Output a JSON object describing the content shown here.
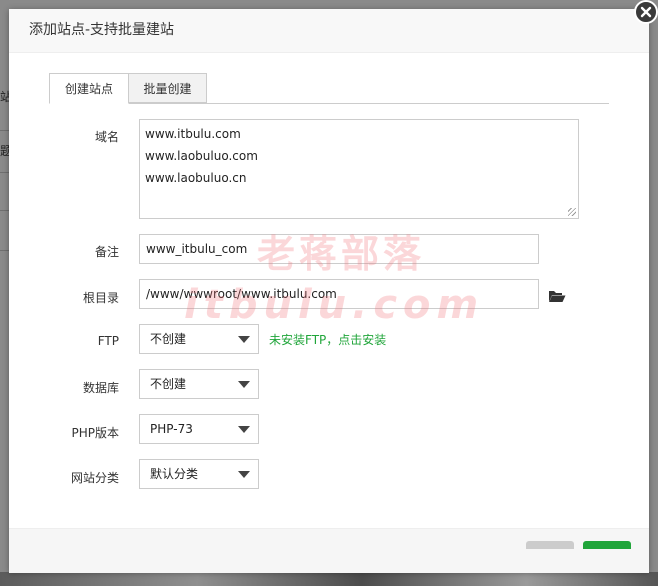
{
  "background": {
    "fragments": [
      "站",
      "题"
    ]
  },
  "dialog": {
    "title": "添加站点-支持批量建站"
  },
  "tabs": [
    {
      "label": "创建站点",
      "active": true
    },
    {
      "label": "批量创建",
      "active": false
    }
  ],
  "form": {
    "domain": {
      "label": "域名",
      "lines": [
        "www.itbulu.com",
        "www.laobuluo.com",
        "www.laobuluo.cn"
      ]
    },
    "note": {
      "label": "备注",
      "value": "www_itbulu_com"
    },
    "root": {
      "label": "根目录",
      "value": "/www/wwwroot/www.itbulu.com"
    },
    "ftp": {
      "label": "FTP",
      "value": "不创建",
      "hint": "未安装FTP，点击安装"
    },
    "database": {
      "label": "数据库",
      "value": "不创建"
    },
    "php": {
      "label": "PHP版本",
      "value": "PHP-73"
    },
    "category": {
      "label": "网站分类",
      "value": "默认分类"
    }
  },
  "watermark": {
    "line1": "老蒋部落",
    "line2": "itbulu.com"
  },
  "colors": {
    "accent_green": "#20a53a",
    "watermark": "#f06e78"
  }
}
